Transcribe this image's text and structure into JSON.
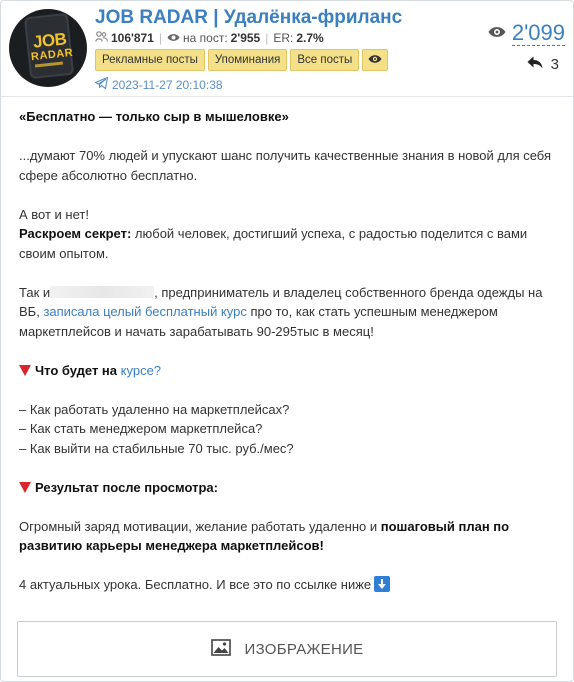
{
  "channel": {
    "title": "JOB RADAR | Удалёнка-фриланс",
    "subscribers": "106'871",
    "reach_label": "на пост:",
    "reach_value": "2'955",
    "er_label": "ER:",
    "er_value": "2.7%",
    "avatar_icon": "job-radar-logo",
    "avatar_text_1": "JOB",
    "avatar_text_2": "RADAR"
  },
  "tabs": [
    {
      "label": "Рекламные посты"
    },
    {
      "label": "Упоминания"
    },
    {
      "label": "Все посты"
    }
  ],
  "post": {
    "date": "2023-11-27 20:10:38",
    "views": "2'099",
    "shares": "3"
  },
  "content": {
    "heading": "«Бесплатно — только сыр в мышеловке»",
    "p1_l1": "...думают 70% людей и упускают шанс получить качественные знания в новой для себя",
    "p1_l2": "сфере абсолютно бесплатно.",
    "p2_l1": "А вот и нет!",
    "p2_bold": "Раскроем секрет:",
    "p2_l2": " любой человек, достигший успеха, с радостью поделится с вами",
    "p2_l3": "своим опытом.",
    "p3_pre": "Так и",
    "p3_post": ", предприниматель и владелец собственного бренда одежды на",
    "p3_l2_pre": "ВБ, ",
    "p3_link": "записала целый бесплатный курс",
    "p3_l2_post": " про то, как стать успешным менеджером",
    "p3_l3": "маркетплейсов и начать зарабатывать 90-295тыс в месяц!",
    "s1_bold": "Что будет на",
    "s1_link": "курсе?",
    "li1": "– Как работать удаленно на маркетплейсах?",
    "li2": "– Как стать менеджером маркетплейса?",
    "li3": "– Как выйти на стабильные 70 тыс. руб./мес?",
    "s2_bold": "Результат после просмотра:",
    "r_l1_pre": "Огромный заряд мотивации, желание работать удаленно и ",
    "r_l1_bold": "пошаговый план по",
    "r_l2_bold": "развитию карьеры менеджера маркетплейсов!",
    "final": "4 актуальных урока. Бесплатно. И все это по ссылке ниже"
  },
  "image_button": {
    "label": "ИЗОБРАЖЕНИЕ",
    "icon": "image-icon"
  },
  "colors": {
    "accent": "#3a7fc0",
    "tab_bg": "#f5e08a",
    "marker_red": "#d8262c",
    "download_blue": "#2f7fd6"
  }
}
